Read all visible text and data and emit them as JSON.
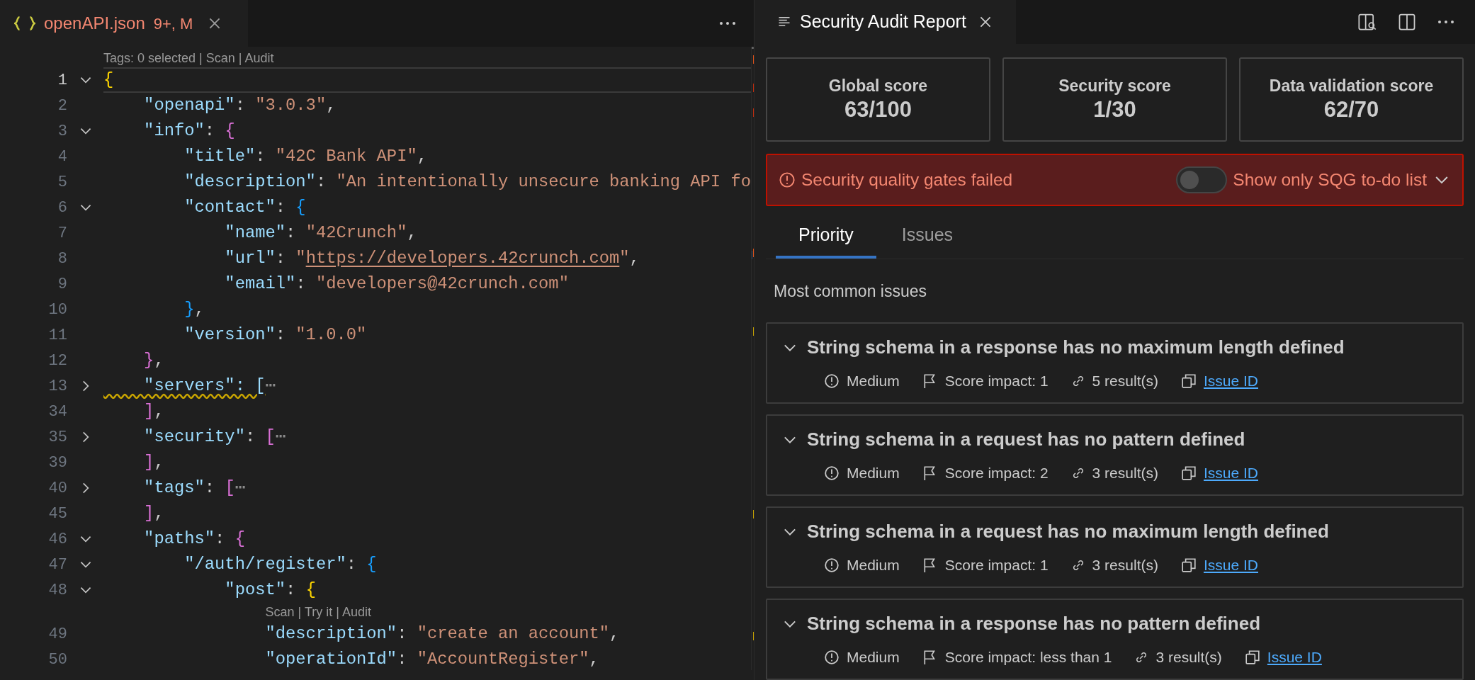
{
  "editor": {
    "tab": {
      "title": "openAPI.json",
      "badge": "9+, M"
    },
    "lines": [
      {
        "kind": "codelens",
        "parts": [
          "Tags: 0 selected | Scan | Audit"
        ]
      },
      {
        "kind": "code",
        "number": "1",
        "fold": {
          "expanded": true
        },
        "current": true,
        "tokens": [
          {
            "kind": "brace1",
            "text": "{"
          }
        ]
      },
      {
        "kind": "code",
        "number": "2",
        "current": false,
        "tokens": [
          {
            "kind": "key",
            "text": "    \"openapi\""
          },
          {
            "kind": "punct",
            "text": ": "
          },
          {
            "kind": "string",
            "text": "\"3.0.3\""
          },
          {
            "kind": "punct",
            "text": ","
          }
        ]
      },
      {
        "kind": "code",
        "number": "3",
        "fold": {
          "expanded": true
        },
        "current": false,
        "tokens": [
          {
            "kind": "key",
            "text": "    \"info\""
          },
          {
            "kind": "punct",
            "text": ": "
          },
          {
            "kind": "brace2",
            "text": "{"
          }
        ]
      },
      {
        "kind": "code",
        "number": "4",
        "current": false,
        "tokens": [
          {
            "kind": "key",
            "text": "        \"title\""
          },
          {
            "kind": "punct",
            "text": ": "
          },
          {
            "kind": "string",
            "text": "\"42C Bank API\""
          },
          {
            "kind": "punct",
            "text": ","
          }
        ]
      },
      {
        "kind": "code",
        "number": "5",
        "current": false,
        "tokens": [
          {
            "kind": "key",
            "text": "        \"description\""
          },
          {
            "kind": "punct",
            "text": ": "
          },
          {
            "kind": "string",
            "text": "\"An intentionally unsecure banking API fo"
          }
        ]
      },
      {
        "kind": "code",
        "number": "6",
        "fold": {
          "expanded": true
        },
        "current": false,
        "tokens": [
          {
            "kind": "key",
            "text": "        \"contact\""
          },
          {
            "kind": "punct",
            "text": ": "
          },
          {
            "kind": "brace3",
            "text": "{"
          }
        ]
      },
      {
        "kind": "code",
        "number": "7",
        "current": false,
        "tokens": [
          {
            "kind": "key",
            "text": "            \"name\""
          },
          {
            "kind": "punct",
            "text": ": "
          },
          {
            "kind": "string",
            "text": "\"42Crunch\""
          },
          {
            "kind": "punct",
            "text": ","
          }
        ]
      },
      {
        "kind": "code",
        "number": "8",
        "current": false,
        "tokens": [
          {
            "kind": "key",
            "text": "            \"url\""
          },
          {
            "kind": "punct",
            "text": ": "
          },
          {
            "kind": "string",
            "text": "\""
          },
          {
            "kind": "link",
            "text": "https://developers.42crunch.com"
          },
          {
            "kind": "string",
            "text": "\""
          },
          {
            "kind": "punct",
            "text": ","
          }
        ]
      },
      {
        "kind": "code",
        "number": "9",
        "current": false,
        "tokens": [
          {
            "kind": "key",
            "text": "            \"email\""
          },
          {
            "kind": "punct",
            "text": ": "
          },
          {
            "kind": "string",
            "text": "\"developers@42crunch.com\""
          }
        ]
      },
      {
        "kind": "code",
        "number": "10",
        "current": false,
        "tokens": [
          {
            "kind": "brace3",
            "text": "        }"
          },
          {
            "kind": "punct",
            "text": ","
          }
        ]
      },
      {
        "kind": "code",
        "number": "11",
        "current": false,
        "tokens": [
          {
            "kind": "key",
            "text": "        \"version\""
          },
          {
            "kind": "punct",
            "text": ": "
          },
          {
            "kind": "string",
            "text": "\"1.0.0\""
          }
        ]
      },
      {
        "kind": "code",
        "number": "12",
        "current": false,
        "tokens": [
          {
            "kind": "brace2",
            "text": "    }"
          },
          {
            "kind": "punct",
            "text": ","
          }
        ]
      },
      {
        "kind": "code",
        "number": "13",
        "fold": {
          "expanded": false
        },
        "current": false,
        "tokens": [
          {
            "kind": "warning",
            "text": "    \"servers\": ["
          },
          {
            "kind": "ellipsis",
            "text": "⋯"
          }
        ]
      },
      {
        "kind": "code",
        "number": "34",
        "current": false,
        "tokens": [
          {
            "kind": "brace2",
            "text": "    ]"
          },
          {
            "kind": "punct",
            "text": ","
          }
        ]
      },
      {
        "kind": "code",
        "number": "35",
        "fold": {
          "expanded": false
        },
        "current": false,
        "tokens": [
          {
            "kind": "key",
            "text": "    \"security\""
          },
          {
            "kind": "punct",
            "text": ": "
          },
          {
            "kind": "brace2",
            "text": "["
          },
          {
            "kind": "ellipsis",
            "text": "⋯"
          }
        ]
      },
      {
        "kind": "code",
        "number": "39",
        "current": false,
        "tokens": [
          {
            "kind": "brace2",
            "text": "    ]"
          },
          {
            "kind": "punct",
            "text": ","
          }
        ]
      },
      {
        "kind": "code",
        "number": "40",
        "fold": {
          "expanded": false
        },
        "current": false,
        "tokens": [
          {
            "kind": "key",
            "text": "    \"tags\""
          },
          {
            "kind": "punct",
            "text": ": "
          },
          {
            "kind": "brace2",
            "text": "["
          },
          {
            "kind": "ellipsis",
            "text": "⋯"
          }
        ]
      },
      {
        "kind": "code",
        "number": "45",
        "current": false,
        "tokens": [
          {
            "kind": "brace2",
            "text": "    ]"
          },
          {
            "kind": "punct",
            "text": ","
          }
        ]
      },
      {
        "kind": "code",
        "number": "46",
        "fold": {
          "expanded": true
        },
        "current": false,
        "tokens": [
          {
            "kind": "key",
            "text": "    \"paths\""
          },
          {
            "kind": "punct",
            "text": ": "
          },
          {
            "kind": "brace2",
            "text": "{"
          }
        ]
      },
      {
        "kind": "code",
        "number": "47",
        "fold": {
          "expanded": true
        },
        "current": false,
        "tokens": [
          {
            "kind": "key",
            "text": "        \"/auth/register\""
          },
          {
            "kind": "punct",
            "text": ": "
          },
          {
            "kind": "brace3",
            "text": "{"
          }
        ]
      },
      {
        "kind": "code",
        "number": "48",
        "fold": {
          "expanded": true
        },
        "current": false,
        "tokens": [
          {
            "kind": "key",
            "text": "            \"post\""
          },
          {
            "kind": "punct",
            "text": ": "
          },
          {
            "kind": "brace1",
            "text": "{"
          }
        ]
      },
      {
        "kind": "codelens",
        "parts": [
          "Scan | Try it | Audit"
        ]
      },
      {
        "kind": "code",
        "number": "49",
        "current": false,
        "tokens": [
          {
            "kind": "key",
            "text": "                \"description\""
          },
          {
            "kind": "punct",
            "text": ": "
          },
          {
            "kind": "string",
            "text": "\"create an account\""
          },
          {
            "kind": "punct",
            "text": ","
          }
        ]
      },
      {
        "kind": "code",
        "number": "50",
        "current": false,
        "tokens": [
          {
            "kind": "key",
            "text": "                \"operationId\""
          },
          {
            "kind": "punct",
            "text": ": "
          },
          {
            "kind": "string",
            "text": "\"AccountRegister\""
          },
          {
            "kind": "punct",
            "text": ","
          }
        ]
      }
    ]
  },
  "report": {
    "tab": {
      "title": "Security Audit Report"
    },
    "scores": [
      {
        "label": "Global score",
        "value": "63/100"
      },
      {
        "label": "Security score",
        "value": "1/30"
      },
      {
        "label": "Data validation score",
        "value": "62/70"
      }
    ],
    "banner": {
      "message": "Security quality gates failed",
      "toggle": {
        "on": false,
        "label": "Show only SQG to-do list"
      }
    },
    "tabs": [
      {
        "label": "Priority",
        "selected": true
      },
      {
        "label": "Issues",
        "selected": false
      }
    ],
    "section_title": "Most common issues",
    "issues": [
      {
        "title": "String schema in a response has no maximum length defined",
        "severity": "Medium",
        "impact": "Score impact: 1",
        "results": "5 result(s)",
        "link": "Issue ID"
      },
      {
        "title": "String schema in a request has no pattern defined",
        "severity": "Medium",
        "impact": "Score impact: 2",
        "results": "3 result(s)",
        "link": "Issue ID"
      },
      {
        "title": "String schema in a request has no maximum length defined",
        "severity": "Medium",
        "impact": "Score impact: 1",
        "results": "3 result(s)",
        "link": "Issue ID"
      },
      {
        "title": "String schema in a response has no pattern defined",
        "severity": "Medium",
        "impact": "Score impact: less than 1",
        "results": "3 result(s)",
        "link": "Issue ID"
      }
    ]
  }
}
